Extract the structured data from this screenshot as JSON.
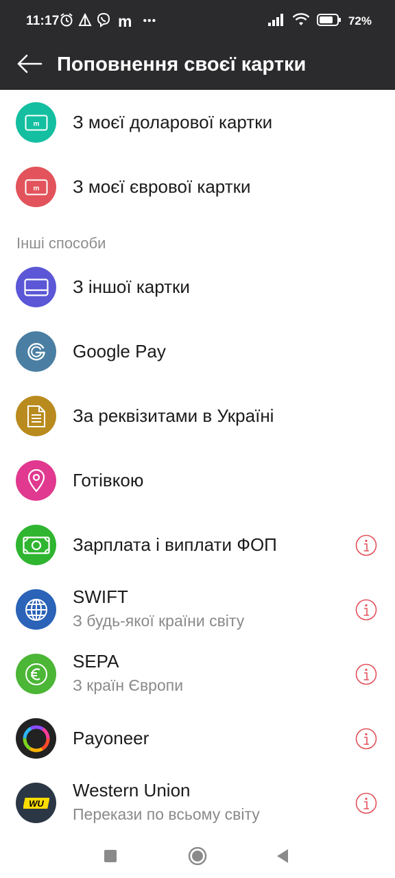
{
  "status_bar": {
    "time": "11:17",
    "app_letter": "m",
    "more": "•••",
    "battery": "72%"
  },
  "header": {
    "title": "Поповнення своєї картки"
  },
  "my_cards": [
    {
      "label": "З моєї доларової картки",
      "icon": "card-m-icon",
      "color": "#13bfa0",
      "badge": "m"
    },
    {
      "label": "З моєї єврової картки",
      "icon": "card-m-icon",
      "color": "#e2535b",
      "badge": "m"
    }
  ],
  "other": {
    "header": "Інші способи",
    "items": [
      {
        "label": "З іншої картки",
        "sub": "",
        "icon": "credit-card-icon",
        "color": "#5b57d6",
        "info": false
      },
      {
        "label": "Google Pay",
        "sub": "",
        "icon": "google-icon",
        "color": "#4a7ea3",
        "info": false
      },
      {
        "label": "За реквізитами в Україні",
        "sub": "",
        "icon": "document-icon",
        "color": "#b98b1f",
        "info": false
      },
      {
        "label": "Готівкою",
        "sub": "",
        "icon": "location-pin-icon",
        "color": "#e0398f",
        "info": false
      },
      {
        "label": "Зарплата і виплати ФОП",
        "sub": "",
        "icon": "banknote-icon",
        "color": "#2fb52f",
        "info": true
      },
      {
        "label": "SWIFT",
        "sub": "З будь-якої країни світу",
        "icon": "globe-icon",
        "color": "#2a63b8",
        "info": true
      },
      {
        "label": "SEPA",
        "sub": "З країн Європи",
        "icon": "euro-icon",
        "color": "#4cb637",
        "info": true
      },
      {
        "label": "Payoneer",
        "sub": "",
        "icon": "payoneer-ring-icon",
        "color": "#222222",
        "info": true
      },
      {
        "label": "Western Union",
        "sub": "Перекази по всьому світу",
        "icon": "western-union-icon",
        "color": "#2b3745",
        "info": true,
        "badge": "WU"
      }
    ]
  },
  "colors": {
    "header_bg": "#2b2b2d",
    "info_red": "#e2535b"
  }
}
